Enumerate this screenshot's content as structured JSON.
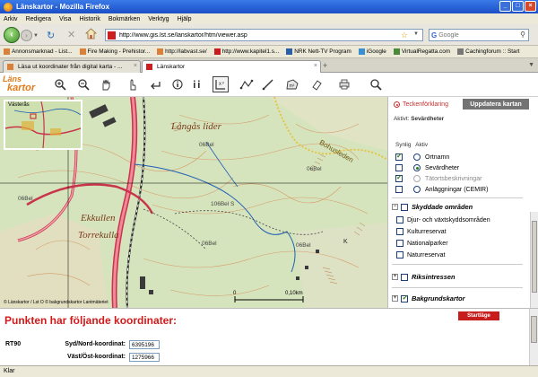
{
  "window": {
    "title": "Länskartor - Mozilla Firefox"
  },
  "menu": [
    "Arkiv",
    "Redigera",
    "Visa",
    "Historik",
    "Bokmärken",
    "Verktyg",
    "Hjälp"
  ],
  "nav": {
    "url": "http://www.gis.lst.se/lanskartor/htm/viewer.asp",
    "search_placeholder": "Google"
  },
  "bookmarks": [
    "Annonsmarknad - List...",
    "Fire Making - Prehistor...",
    "http://labvast.se/",
    "http://www.kapitel1.s...",
    "NRK Nett-TV Program",
    "iGoogle",
    "VirtualRegatta.com",
    "Cachingforum :: Start"
  ],
  "tabs": [
    {
      "label": "Läsa ut koordinater från digital karta - ...",
      "active": false
    },
    {
      "label": "Länskartor",
      "active": true
    }
  ],
  "app": {
    "logo_top": "Läns",
    "logo_bottom": "kartor",
    "tools": [
      "zoom-in-icon",
      "zoom-out-icon",
      "pan-icon",
      "hand-icon",
      "back-arrow-icon",
      "info-icon",
      "double-info-icon",
      "coordinate-icon",
      "measure-distance-icon",
      "measure-area-icon",
      "eraser-icon",
      "search-icon"
    ]
  },
  "map": {
    "overview_title": "Västerås",
    "labels": {
      "langas_lider": "Långås lider",
      "ekkullen": "Ekkullen",
      "torrekulla": "Torrekulla",
      "bohusleden": "Bohusleden",
      "grid1": "06Bel",
      "grid2": "06Bel",
      "grid3": "06Bel",
      "grid4": "06Bel",
      "grid5": "06Bel",
      "grid_center": "106Bel S",
      "k": "K"
    },
    "copyright": "© Länskartor / Lst O  © bakgrundskartor Lantmäteriet",
    "scale_start": "0",
    "scale_end": "0,10km"
  },
  "panel": {
    "legend_link": "Teckenförklaring",
    "update_button": "Uppdatera kartan",
    "active_label": "Aktivt:",
    "active_value": "Sevärdheter",
    "col_visible": "Synlig",
    "col_active": "Aktiv",
    "layers": [
      {
        "label": "Ortnamn",
        "visible": true,
        "active": false,
        "disabled": false
      },
      {
        "label": "Sevärdheter",
        "visible": false,
        "active": true,
        "disabled": false
      },
      {
        "label": "Tätortsbeskrivningar",
        "visible": true,
        "active": false,
        "disabled": true
      },
      {
        "label": "Anläggningar (CEMIR)",
        "visible": false,
        "active": false,
        "disabled": false
      }
    ],
    "section_protected": "Skyddade områden",
    "protected_items": [
      "Djur- och växtskyddsområden",
      "Kulturreservat",
      "Nationalparker",
      "Naturreservat"
    ],
    "section_interests": "Riksintressen",
    "section_background": "Bakgrundskartor"
  },
  "coords": {
    "title": "Punkten har följande koordinater:",
    "start_button": "Startläge",
    "system": "RT90",
    "north_label": "Syd/Nord-koordinat:",
    "north_value": "6395196",
    "east_label": "Väst/Öst-koordinat:",
    "east_value": "1275966"
  },
  "status": {
    "text": "Klar"
  }
}
